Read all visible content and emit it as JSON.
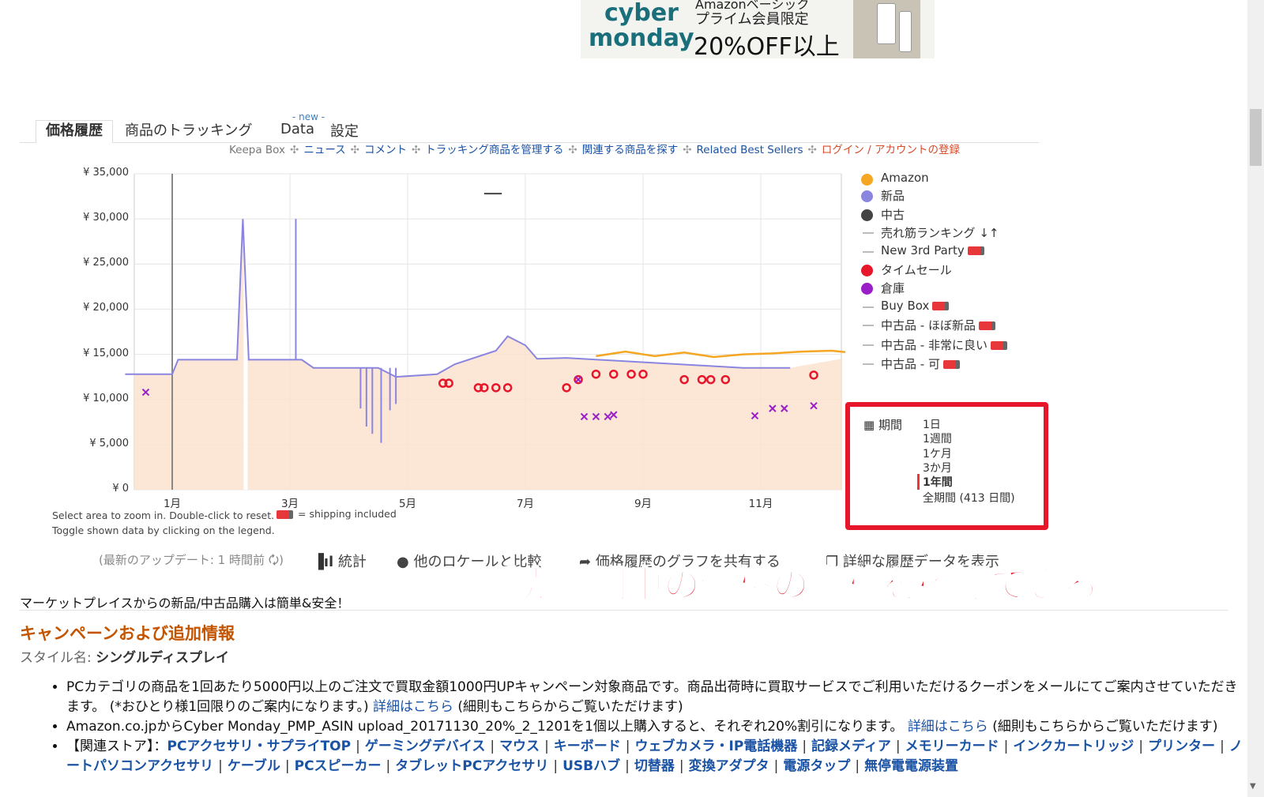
{
  "banner": {
    "top_text": "Amazonベーシック",
    "cyber": "cyber",
    "monday": "monday",
    "prime": "プライム会員限定",
    "off": "20%OFF以上"
  },
  "tabs": {
    "price_history": "価格履歴",
    "tracking": "商品のトラッキング",
    "new_badge": "- new -",
    "data": "Data",
    "settings": "設定"
  },
  "top_links": {
    "keepa_box": "Keepa Box",
    "news": "ニュース",
    "comment": "コメント",
    "manage": "トラッキング商品を管理する",
    "related_search": "関連する商品を探す",
    "related_best": "Related Best Sellers",
    "login": "ログイン / アカウントの登録",
    "sep": "✣"
  },
  "chart_data": {
    "type": "line",
    "x_ticks": [
      "1月",
      "3月",
      "5月",
      "7月",
      "9月",
      "11月"
    ],
    "y_ticks": [
      "¥ 35,000",
      "¥ 30,000",
      "¥ 25,000",
      "¥ 20,000",
      "¥ 15,000",
      "¥ 10,000",
      "¥ 5,000",
      "¥ 0"
    ],
    "ylim": [
      0,
      35000
    ],
    "series": [
      {
        "name": "Amazon",
        "color": "#f5a623",
        "x": [
          8.0,
          8.5,
          9.0,
          9.5,
          10.0,
          10.5,
          11.0,
          11.5,
          12.0,
          12.3
        ],
        "values": [
          14800,
          15300,
          14800,
          15200,
          14700,
          15000,
          15100,
          15300,
          15400,
          15200
        ]
      },
      {
        "name": "新品",
        "color": "#8a86e0",
        "x": [
          0.0,
          0.8,
          0.9,
          1.0,
          1.9,
          2.0,
          2.1,
          3.0,
          3.2,
          4.3,
          4.6,
          5.3,
          5.6,
          6.3,
          6.5,
          6.8,
          7.0,
          7.5,
          10.5,
          11.3
        ],
        "values": [
          12800,
          12800,
          14400,
          14400,
          14400,
          30000,
          14400,
          14400,
          13500,
          13500,
          12500,
          12800,
          13900,
          15400,
          17000,
          16000,
          14500,
          14600,
          13500,
          13500
        ]
      },
      {
        "name": "中古",
        "color": "#444444",
        "x": [
          6.1,
          6.4
        ],
        "values": [
          32800,
          32800
        ]
      },
      {
        "name": "タイムセール",
        "color": "#e8162a",
        "x": [
          5.4,
          5.5,
          6.0,
          6.1,
          6.3,
          6.5,
          7.5,
          7.7,
          8.0,
          8.3,
          8.6,
          8.8,
          9.5,
          9.8,
          9.95,
          10.2,
          11.7
        ],
        "values": [
          11800,
          11800,
          11300,
          11300,
          11300,
          11300,
          11300,
          12200,
          12800,
          12800,
          12800,
          12800,
          12200,
          12200,
          12200,
          12200,
          12700
        ]
      },
      {
        "name": "倉庫",
        "color": "#9b1fc9",
        "x": [
          0.35,
          7.7,
          7.8,
          8.0,
          8.2,
          8.3,
          10.7,
          11.0,
          11.2,
          11.7
        ],
        "values": [
          10800,
          12200,
          8100,
          8100,
          8100,
          8300,
          8200,
          9000,
          9000,
          9300
        ]
      }
    ]
  },
  "legend": [
    {
      "label": "Amazon",
      "kind": "dot",
      "color": "#f5a623"
    },
    {
      "label": "新品",
      "kind": "dot",
      "color": "#8a86e0"
    },
    {
      "label": "中古",
      "kind": "dot",
      "color": "#444444"
    },
    {
      "label": "売れ筋ランキング ↓↑",
      "kind": "dash",
      "color": "#bbbbbb"
    },
    {
      "label": "New 3rd Party",
      "kind": "dash",
      "color": "#bbbbbb",
      "truck": true
    },
    {
      "label": "タイムセール",
      "kind": "dot",
      "color": "#e8162a"
    },
    {
      "label": "倉庫",
      "kind": "dot",
      "color": "#9b1fc9"
    },
    {
      "label": "Buy Box",
      "kind": "dash",
      "color": "#bbbbbb",
      "truck": true
    },
    {
      "label": "中古品 - ほぼ新品",
      "kind": "dash",
      "color": "#bbbbbb",
      "truck": true
    },
    {
      "label": "中古品 - 非常に良い",
      "kind": "dash",
      "color": "#bbbbbb",
      "truck": true
    },
    {
      "label": "中古品 - 可",
      "kind": "dash",
      "color": "#bbbbbb",
      "truck": true
    }
  ],
  "range": {
    "label": "期間",
    "options": [
      "1日",
      "1週間",
      "1ケ月",
      "3か月",
      "1年間",
      "全期間 (413 日間)"
    ],
    "active": "1年間"
  },
  "notes": {
    "zoom": "Select area to zoom in. Double-click to reset.",
    "toggle": "Toggle shown data by clicking on the legend.",
    "shipping": "= shipping included"
  },
  "actions": {
    "update": "(最新のアップデート: 1 時間前 🗘)",
    "stats": "統計",
    "compare": "他のロケールと比較",
    "share": "価格履歴のグラフを共有する",
    "detail": "詳細な履歴データを表示"
  },
  "overlay_text": "販売期間中の価格の推移を確認できる。",
  "marketplace": "マーケットプレイスからの新品/中古品購入は簡単&安全！",
  "campaign_title": "キャンペーンおよび追加情報",
  "style": {
    "label": "スタイル名:",
    "value": "シングルディスプレイ"
  },
  "info": {
    "item1_a": "PCカテゴリの商品を1回あたり5000円以上のご注文で買取金額1000円UPキャンペーン対象商品です。商品出荷時に買取サービスでご利用いただけるクーポンをメールにてご案内させていただきます。 (*おひとり様1回限りのご案内になります。)",
    "item1_link": "詳細はこちら",
    "item1_b": "(細則もこちらからご覧いただけます)",
    "item2_a": "Amazon.co.jpからCyber Monday_PMP_ASIN upload_20171130_20%_2_1201を1個以上購入すると、それぞれ20%割引になります。",
    "item2_link": "詳細はこちら",
    "item2_b": "(細則もこちらからご覧いただけます)",
    "item3_prefix": "【関連ストア】：",
    "stores": [
      "PCアクセサリ・サプライTOP",
      "ゲーミングデバイス",
      "マウス",
      "キーボード",
      "ウェブカメラ・IP電話機器",
      "記録メディア",
      "メモリーカード",
      "インクカートリッジ",
      "プリンター",
      "ノートパソコンアクセサリ",
      "ケーブル",
      "PCスピーカー",
      "タブレットPCアクセサリ",
      "USBハブ",
      "切替器",
      "変換アダプタ",
      "電源タップ",
      "無停電電源装置"
    ]
  }
}
